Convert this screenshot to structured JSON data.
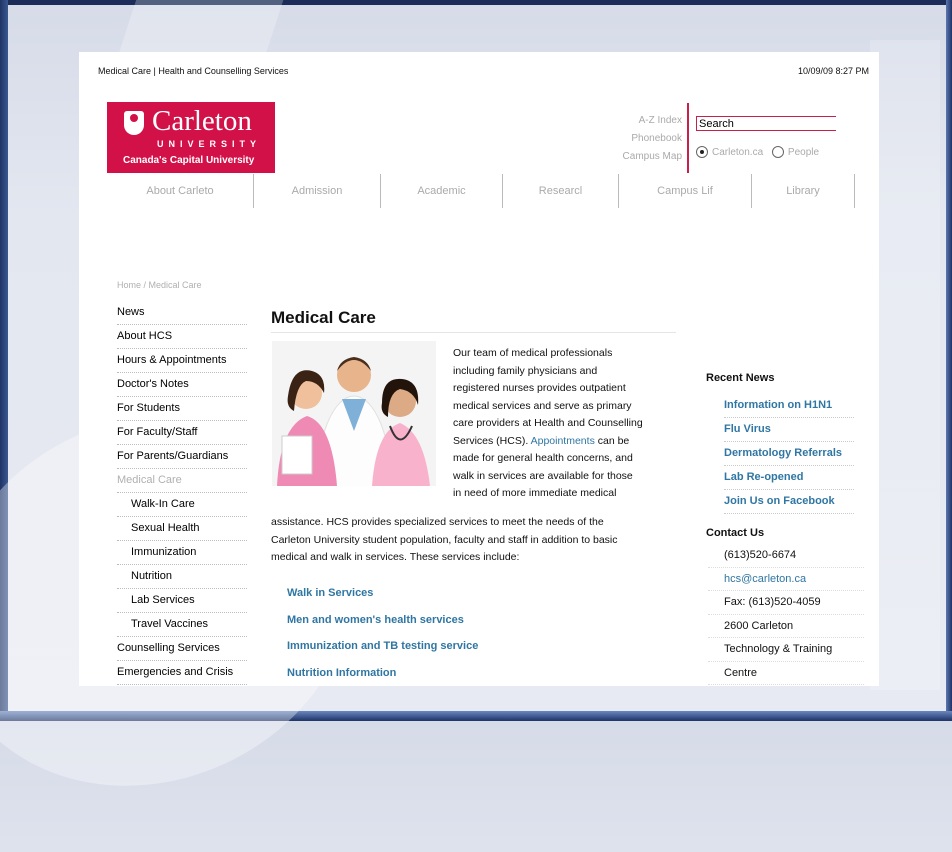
{
  "page_meta": {
    "title": "Medical Care | Health and Counselling Services",
    "datetime": "10/09/09 8:27 PM"
  },
  "logo": {
    "name": "Carleton",
    "university": "UNIVERSITY",
    "tagline": "Canada's Capital University"
  },
  "utility_links": [
    "A-Z Index",
    "Phonebook",
    "Campus Map"
  ],
  "search": {
    "value": "Search",
    "options": [
      "Carleton.ca",
      "People"
    ],
    "selected": "Carleton.ca"
  },
  "main_nav": [
    "About Carleto",
    "Admission",
    "Academic",
    "Researcl",
    "Campus Lif",
    "Library"
  ],
  "breadcrumb": "Home / Medical Care",
  "side_nav": [
    {
      "label": "News",
      "sub": false,
      "muted": false
    },
    {
      "label": "About HCS",
      "sub": false,
      "muted": false
    },
    {
      "label": "Hours & Appointments",
      "sub": false,
      "muted": false
    },
    {
      "label": "Doctor's Notes",
      "sub": false,
      "muted": false
    },
    {
      "label": "For Students",
      "sub": false,
      "muted": false
    },
    {
      "label": "For Faculty/Staff",
      "sub": false,
      "muted": false
    },
    {
      "label": "For Parents/Guardians",
      "sub": false,
      "muted": false
    },
    {
      "label": "Medical Care",
      "sub": false,
      "muted": true
    },
    {
      "label": "Walk-In Care",
      "sub": true,
      "muted": false
    },
    {
      "label": "Sexual Health",
      "sub": true,
      "muted": false
    },
    {
      "label": "Immunization",
      "sub": true,
      "muted": false
    },
    {
      "label": "Nutrition",
      "sub": true,
      "muted": false
    },
    {
      "label": "Lab Services",
      "sub": true,
      "muted": false
    },
    {
      "label": "Travel Vaccines",
      "sub": true,
      "muted": false
    },
    {
      "label": "Counselling Services",
      "sub": false,
      "muted": false
    },
    {
      "label": "Emergencies and Crisis",
      "sub": false,
      "muted": false
    }
  ],
  "main": {
    "title": "Medical Care",
    "intro_lines": [
      "Our team of medical professionals",
      "including family physicians and",
      "registered nurses provides outpatient",
      "medical services and serve as primary",
      "care providers at Health and Counselling"
    ],
    "line_before_link": "Services (HCS). ",
    "appointments_link": "Appointments",
    "line_after_link": " can be",
    "intro_tail_lines": [
      "made for general health concerns, and",
      "walk in services are available for those",
      "in need of more immediate medical"
    ],
    "rest_lines": [
      "assistance. HCS provides specialized services to meet the needs of the",
      "Carleton University student population, faculty and staff in addition to basic",
      "medical and walk in services. These services include:"
    ],
    "services": [
      "Walk in Services",
      "Men and women's health services",
      "Immunization and TB testing service",
      "Nutrition Information"
    ]
  },
  "recent_news": {
    "heading": "Recent News",
    "items": [
      "Information on H1N1",
      "Flu Virus",
      "Dermatology Referrals",
      "Lab Re-opened",
      "Join Us on Facebook"
    ]
  },
  "contact": {
    "heading": "Contact Us",
    "phone": "(613)520-6674",
    "email": "hcs@carleton.ca",
    "fax": "Fax: (613)520-4059",
    "address_lines": [
      "2600 Carleton",
      "Technology & Training",
      "Centre"
    ]
  },
  "colors": {
    "brand_red": "#d21148",
    "link_blue": "#2f76a3"
  }
}
